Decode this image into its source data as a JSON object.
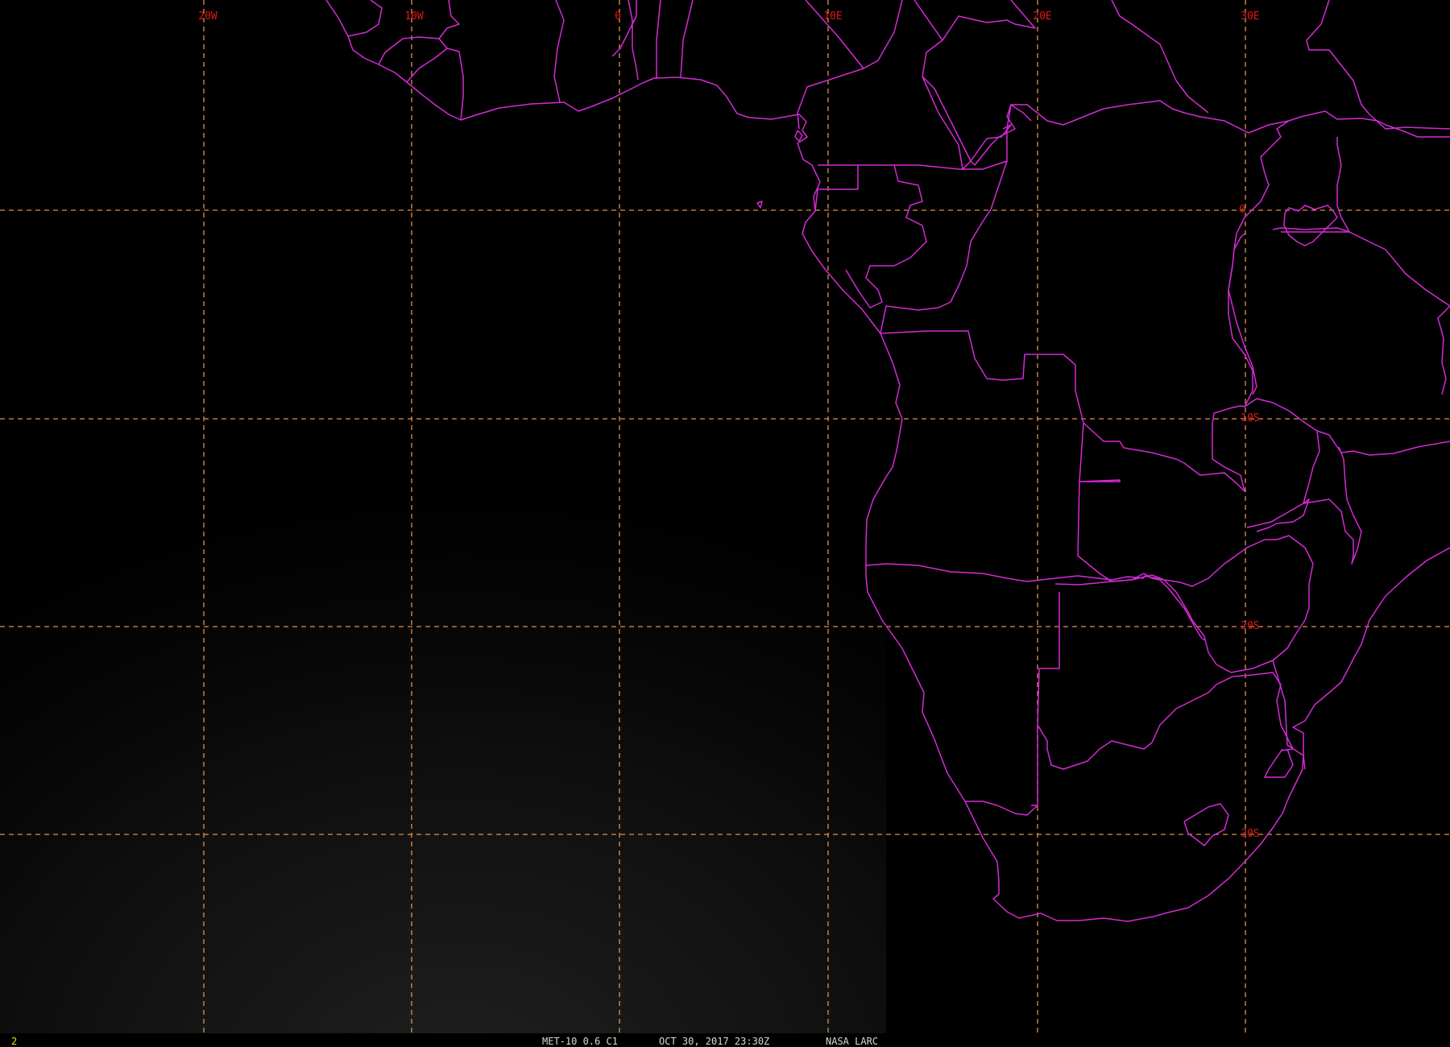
{
  "colors": {
    "background": "#000000",
    "grid": "#e0904a",
    "grid_label": "#e01818",
    "borders": "#d52ad5",
    "status_text": "#d8d8d8",
    "frame_number": "#e6e600"
  },
  "map": {
    "lon_labels": [
      "20W",
      "10W",
      "0",
      "10E",
      "20E",
      "30E"
    ],
    "lat_labels": [
      "0",
      "10S",
      "20S",
      "30S"
    ]
  },
  "status_bar": {
    "frame": "2",
    "sensor": "MET-10 0.6 C1",
    "datetime": "OCT 30, 2017 23:30Z",
    "source": "NASA LARC"
  }
}
